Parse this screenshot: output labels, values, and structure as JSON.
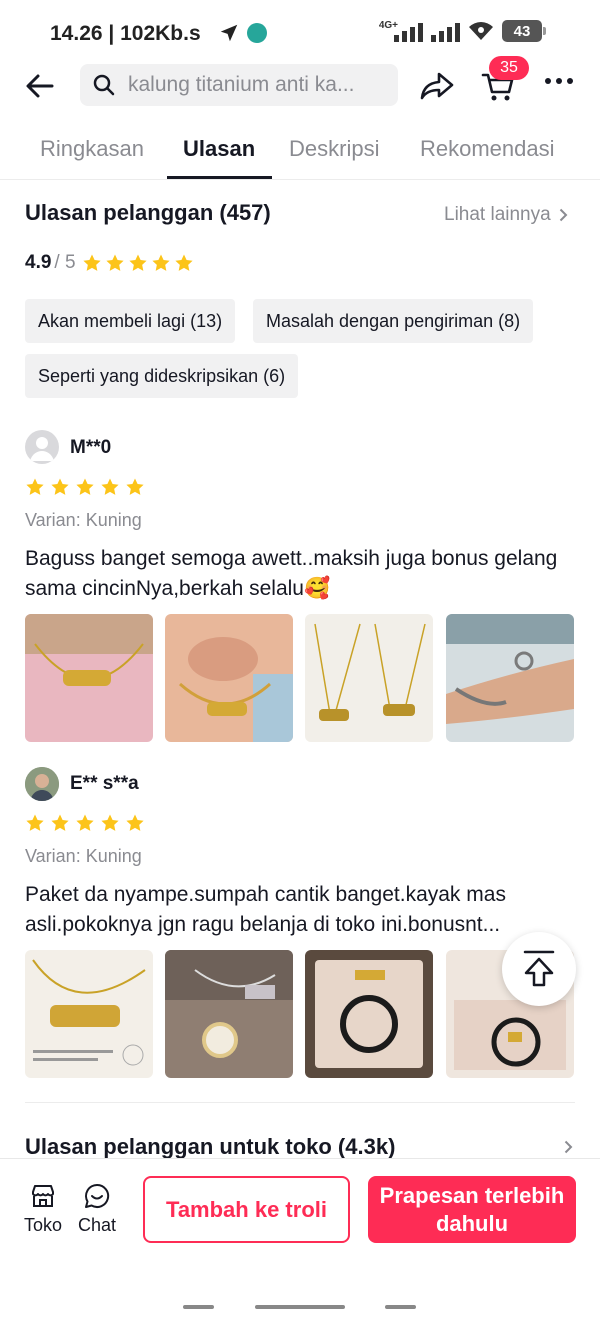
{
  "status_bar": {
    "time_speed": "14.26 | 102Kb.s",
    "network": "4G+",
    "battery": "43"
  },
  "header": {
    "search_placeholder": "kalung titanium anti ka...",
    "cart_count": "35"
  },
  "tabs": [
    {
      "label": "Ringkasan",
      "active": false
    },
    {
      "label": "Ulasan",
      "active": true
    },
    {
      "label": "Deskripsi",
      "active": false
    },
    {
      "label": "Rekomendasi",
      "active": false
    }
  ],
  "reviews_section": {
    "title": "Ulasan pelanggan (457)",
    "see_more": "Lihat lainnya",
    "score": "4.9",
    "out_of": "/ 5",
    "stars": 5,
    "chips": [
      "Akan membeli lagi (13)",
      "Masalah dengan pengiriman (8)",
      "Seperti yang dideskripsikan (6)"
    ]
  },
  "reviews": [
    {
      "user": "M**0",
      "stars": 5,
      "variant": "Varian: Kuning",
      "text": "Baguss banget semoga awett..maksih juga bonus gelang sama cincinNya,berkah selalu🥰"
    },
    {
      "user": "E** s**a",
      "stars": 5,
      "variant": "Varian: Kuning",
      "text": "Paket da nyampe.sumpah cantik banget.kayak mas asli.pokoknya jgn ragu belanja di toko ini.bonusnt..."
    }
  ],
  "store_reviews": {
    "title": "Ulasan pelanggan untuk toko (4.3k)"
  },
  "bottom_bar": {
    "store_label": "Toko",
    "chat_label": "Chat",
    "add_to_cart": "Tambah ke troli",
    "preorder": "Prapesan terlebih dahulu"
  },
  "colors": {
    "accent": "#fe2c55",
    "star": "#fcc419",
    "muted_text": "#8a8b91"
  }
}
